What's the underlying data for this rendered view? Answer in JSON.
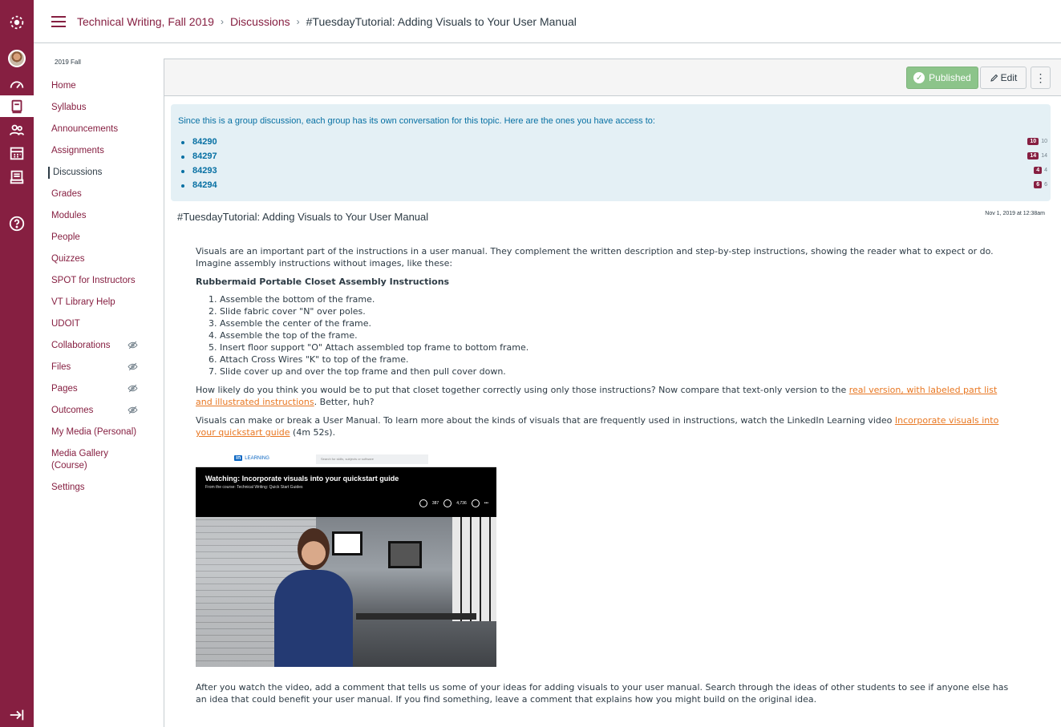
{
  "breadcrumb": {
    "course": "Technical Writing, Fall 2019",
    "section": "Discussions",
    "current": "#TuesdayTutorial: Adding Visuals to Your User Manual"
  },
  "course_nav": {
    "term": "2019 Fall",
    "items": [
      {
        "label": "Home"
      },
      {
        "label": "Syllabus"
      },
      {
        "label": "Announcements"
      },
      {
        "label": "Assignments"
      },
      {
        "label": "Discussions",
        "active": true
      },
      {
        "label": "Grades"
      },
      {
        "label": "Modules"
      },
      {
        "label": "People"
      },
      {
        "label": "Quizzes"
      },
      {
        "label": "SPOT for Instructors"
      },
      {
        "label": "VT Library Help"
      },
      {
        "label": "UDOIT"
      },
      {
        "label": "Collaborations",
        "hidden_icon": true
      },
      {
        "label": "Files",
        "hidden_icon": true
      },
      {
        "label": "Pages",
        "hidden_icon": true
      },
      {
        "label": "Outcomes",
        "hidden_icon": true
      },
      {
        "label": "My Media (Personal)"
      },
      {
        "label": "Media Gallery (Course)"
      },
      {
        "label": "Settings"
      }
    ]
  },
  "toolbar": {
    "published_label": "Published",
    "edit_label": "Edit",
    "more_label": "⋮"
  },
  "groups": {
    "note": "Since this is a group discussion, each group has its own conversation for this topic. Here are the ones you have access to:",
    "items": [
      {
        "name": "84290",
        "unread": "10",
        "total": "10"
      },
      {
        "name": "84297",
        "unread": "14",
        "total": "14"
      },
      {
        "name": "84293",
        "unread": "4",
        "total": "4"
      },
      {
        "name": "84294",
        "unread": "6",
        "total": "6"
      }
    ]
  },
  "topic": {
    "title": "#TuesdayTutorial: Adding Visuals to Your User Manual",
    "date": "Nov 1, 2019 at 12:38am",
    "intro": "Visuals are an important part of the instructions in a user manual. They complement the written description and step-by-step instructions, showing the reader what to expect or do. Imagine assembly instructions without images, like these:",
    "heading": "Rubbermaid Portable Closet Assembly Instructions",
    "steps": [
      "Assemble the bottom of the frame.",
      "Slide fabric cover \"N\" over poles.",
      "Assemble the center of the frame.",
      "Assemble the top of the frame.",
      "Insert floor support \"O\" Attach assembled top frame to bottom frame.",
      "Attach Cross Wires \"K\" to top of the frame.",
      "Slide cover up and over the top frame and then pull cover down."
    ],
    "compare_pre": "How likely do you think you would be to put that closet together correctly using only those instructions? Now compare that text-only version to the ",
    "compare_link": "real version, with labeled part list and illustrated instructions",
    "compare_post": ". Better, huh?",
    "visuals_pre": "Visuals can make or break a User Manual. To learn more about the kinds of visuals that are frequently used in instructions, watch the LinkedIn Learning video ",
    "visuals_link": "Incorporate visuals into your quickstart guide",
    "visuals_post": " (4m 52s).",
    "closing": "After you watch the video, add a comment that tells us some of your ideas for adding visuals to your user manual. Search through the ideas of other students to see if anyone else has an idea that could benefit your user manual. If you find something, leave a comment that explains how you might build on the original idea."
  },
  "video": {
    "logo_text": "LEARNING",
    "logo_in": "in",
    "search_placeholder": "Search for skills, subjects or software",
    "watching_label": "Watching: Incorporate visuals into your quickstart guide",
    "course_label": "From the course: Technical Writing: Quick Start Guides",
    "likes": "387",
    "saves": "4,736"
  },
  "icons": {
    "brand": "#861f41",
    "link": "#0770a3",
    "accent_link": "#e87722"
  }
}
